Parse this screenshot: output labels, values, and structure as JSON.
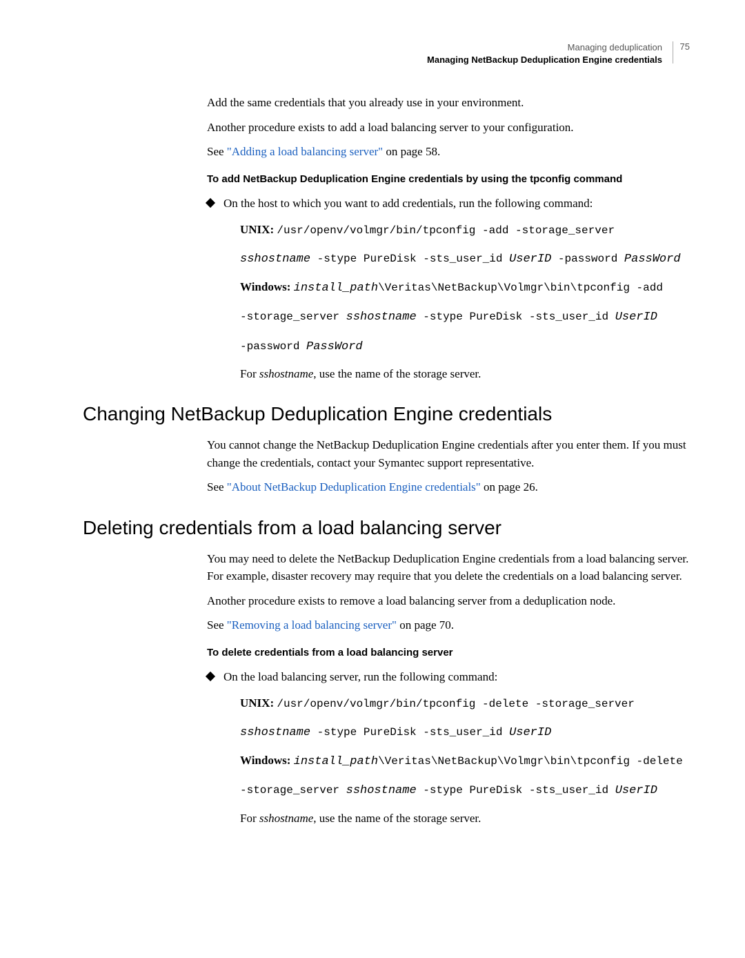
{
  "header": {
    "line1": "Managing deduplication",
    "line2": "Managing NetBackup Deduplication Engine credentials",
    "page_num": "75"
  },
  "intro": {
    "p1": "Add the same credentials that you already use in your environment.",
    "p2": "Another procedure exists to add a load balancing server to your configuration.",
    "see_prefix": "See ",
    "see_link": "\"Adding a load balancing server\"",
    "see_suffix": " on page 58.",
    "sub_heading": "To add NetBackup Deduplication Engine credentials by using the tpconfig command",
    "bullet": "On the host to which you want to add credentials, run the following command:",
    "unix_label": "UNIX: ",
    "unix_cmd1": "/usr/openv/volmgr/bin/tpconfig -add -storage_server",
    "unix_host": "sshostname",
    "unix_cmd2": " -stype PureDisk -sts_user_id ",
    "unix_user": "UserID",
    "unix_cmd3": " -password ",
    "unix_pass": "PassWord",
    "win_label": "Windows: ",
    "win_install": "install_path",
    "win_cmd1": "\\Veritas\\NetBackup\\Volmgr\\bin\\tpconfig -add",
    "win_cmd2": "-storage_server ",
    "win_host": "sshostname",
    "win_cmd3": " -stype PureDisk -sts_user_id ",
    "win_user": "UserID",
    "win_cmd4": "-password ",
    "win_pass": "PassWord",
    "closing_prefix": "For ",
    "closing_ital": "sshostname",
    "closing_suffix": ", use the name of the storage server."
  },
  "changing": {
    "title": "Changing NetBackup Deduplication Engine credentials",
    "p1": "You cannot change the NetBackup Deduplication Engine credentials after you enter them. If you must change the credentials, contact your Symantec support representative.",
    "see_prefix": "See ",
    "see_link": "\"About NetBackup Deduplication Engine credentials\"",
    "see_suffix": " on page 26."
  },
  "deleting": {
    "title": "Deleting credentials from a load balancing server",
    "p1": "You may need to delete the NetBackup Deduplication Engine credentials from a load balancing server. For example, disaster recovery may require that you delete the credentials on a load balancing server.",
    "p2": "Another procedure exists to remove a load balancing server from a deduplication node.",
    "see_prefix": "See ",
    "see_link": "\"Removing a load balancing server\"",
    "see_suffix": " on page 70.",
    "sub_heading": "To delete credentials from a load balancing server",
    "bullet": "On the load balancing server, run the following command:",
    "unix_label": "UNIX: ",
    "unix_cmd1": "/usr/openv/volmgr/bin/tpconfig -delete -storage_server",
    "unix_host": "sshostname",
    "unix_cmd2": " -stype PureDisk -sts_user_id ",
    "unix_user": "UserID",
    "win_label": "Windows: ",
    "win_install": "install_path",
    "win_cmd1": "\\Veritas\\NetBackup\\Volmgr\\bin\\tpconfig -delete",
    "win_cmd2": "-storage_server ",
    "win_host": "sshostname",
    "win_cmd3": " -stype PureDisk -sts_user_id ",
    "win_user": "UserID",
    "closing_prefix": "For ",
    "closing_ital": "sshostname",
    "closing_suffix": ", use the name of the storage server."
  }
}
